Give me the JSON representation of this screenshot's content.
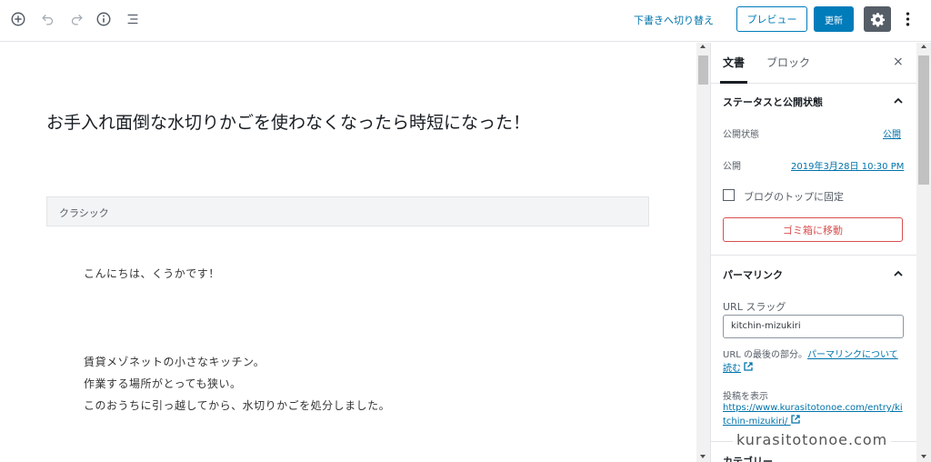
{
  "toolbar": {
    "switch_to_draft": "下書きへ切り替え",
    "preview_label": "プレビュー",
    "update_label": "更新"
  },
  "post": {
    "title": "お手入れ面倒な水切りかごを使わなくなったら時短になった！",
    "classic_block_label": "クラシック",
    "paragraphs": [
      "こんにちは、くうかです！",
      "賃貸メゾネットの小さなキッチン。",
      "作業する場所がとっても狭い。",
      "このおうちに引っ越してから、水切りかごを処分しました。"
    ]
  },
  "sidebar": {
    "tab_document": "文書",
    "tab_block": "ブロック",
    "close_label": "×",
    "status_panel": {
      "heading": "ステータスと公開状態",
      "visibility_label": "公開状態",
      "visibility_value": "公開",
      "publish_label": "公開",
      "publish_value": "2019年3月28日 10:30 PM",
      "sticky_label": "ブログのトップに固定",
      "trash_label": "ゴミ箱に移動"
    },
    "permalink_panel": {
      "heading": "パーマリンク",
      "slug_label": "URL スラッグ",
      "slug_value": "kitchin-mizukiri",
      "help_prefix": "URL の最後の部分。",
      "help_link": "パーマリンクについて読む",
      "view_post_label": "投稿を表示",
      "view_post_url": "https://www.kurasitotonoe.com/entry/kitchin-mizukiri/"
    },
    "category_heading": "カテゴリー"
  },
  "watermark": "kurasitotonoe.com",
  "colors": {
    "accent": "#007cba",
    "link": "#0073aa",
    "danger": "#d94f4f",
    "settings_bg": "#555d66"
  },
  "icons": {
    "add_block": "plus-circle-icon",
    "undo": "undo-icon",
    "redo": "redo-icon",
    "info": "info-icon",
    "outline": "list-outline-icon",
    "settings": "gear-icon",
    "more": "more-vertical-icon",
    "external": "external-link-icon",
    "collapse": "chevron-up-icon"
  }
}
